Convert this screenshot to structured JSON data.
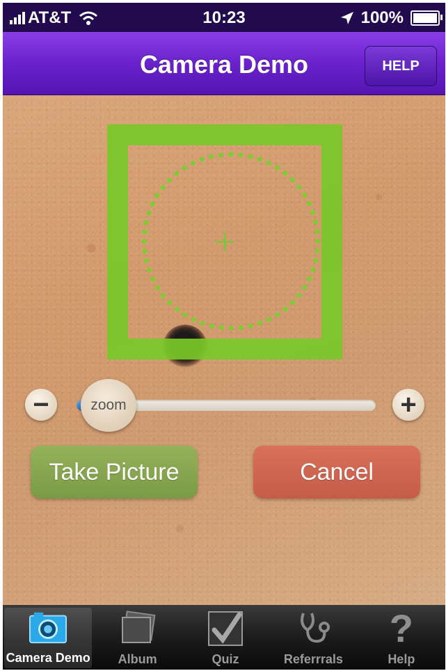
{
  "status_bar": {
    "carrier": "AT&T",
    "time": "10:23",
    "battery": "100%",
    "battery_level": 1.0
  },
  "nav_bar": {
    "title": "Camera Demo",
    "help_label": "HELP"
  },
  "camera": {
    "zoom_label": "zoom",
    "zoom_minus_icon": "minus-icon",
    "zoom_plus_icon": "plus-icon",
    "zoom_level": 0.02,
    "frame_color": "#78c828"
  },
  "actions": {
    "take_picture_label": "Take Picture",
    "cancel_label": "Cancel",
    "take_picture_color": "#8aa84f",
    "cancel_color": "#d0644f"
  },
  "tab_bar": {
    "active_index": 0,
    "items": [
      {
        "label": "Camera Demo",
        "icon": "camera-icon"
      },
      {
        "label": "Album",
        "icon": "album-icon"
      },
      {
        "label": "Quiz",
        "icon": "checkmark-icon"
      },
      {
        "label": "Referrrals",
        "icon": "stethoscope-icon"
      },
      {
        "label": "Help",
        "icon": "question-mark-icon"
      }
    ]
  }
}
